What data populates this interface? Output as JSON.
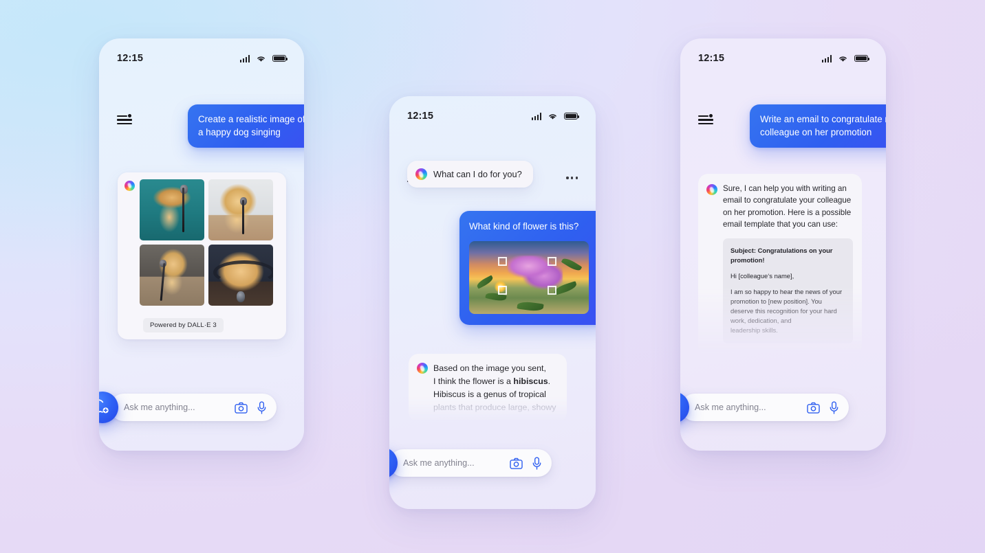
{
  "background": {
    "from": "#cfe9fa",
    "to": "#e6d9f5"
  },
  "accent": {
    "blue": "#2f5ff0",
    "bubble_user_bg": "#3574f0",
    "bot_bubble_bg": "#f6f5fa"
  },
  "status_bar": {
    "time": "12:15",
    "icons": [
      "signal-icon",
      "wifi-icon",
      "battery-icon"
    ]
  },
  "nav": {
    "menu_icon": "list-options-icon",
    "overflow_icon": "more-options-icon"
  },
  "composer": {
    "placeholder": "Ask me anything...",
    "camera_icon": "camera-icon",
    "mic_icon": "microphone-icon",
    "new_chat_icon": "new-chat-icon"
  },
  "phones": [
    {
      "id": "left",
      "name": "image-generation-conversation",
      "messages": [
        {
          "role": "user",
          "text": "Create a realistic image of a happy dog singing"
        }
      ],
      "image_card": {
        "avatar": "copilot-logo",
        "badge": "Powered by DALL·E 3",
        "thumbnails": [
          {
            "alt": "dog standing singing into microphone on teal background"
          },
          {
            "alt": "golden retriever singing with sheet music"
          },
          {
            "alt": "dog sitting beside microphone stand on stage"
          },
          {
            "alt": "dog with headphones singing into microphone"
          }
        ]
      }
    },
    {
      "id": "middle",
      "name": "flower-identification-conversation",
      "messages": [
        {
          "role": "assistant",
          "text": "What can I do for you?"
        },
        {
          "role": "user",
          "text": "What kind of flower is this?",
          "attachment": "pink hibiscus flowers at sunset"
        },
        {
          "role": "assistant",
          "lines": [
            "Based on the image you sent,",
            "I think the flower is a ",
            "Hibiscus is a genus of tropical",
            "plants that produce large, showy"
          ],
          "bold_word": "hibiscus",
          "bold_suffix": "."
        }
      ]
    },
    {
      "id": "right",
      "name": "email-drafting-conversation",
      "messages": [
        {
          "role": "user",
          "text": "Write an email to congratulate my colleague on her promotion"
        },
        {
          "role": "assistant",
          "text": "Sure, I can help you with writing an email to congratulate your colleague on her promotion. Here is a possible email template that you can use:"
        }
      ],
      "email_template": {
        "subject": "Subject: Congratulations on your promotion!",
        "greeting": "Hi [colleague‘s name],",
        "body": "I am so happy to hear the news of your promotion to [new position]. You deserve this recognition for your hard work, dedication, and",
        "body_tail": "leadership skills."
      }
    }
  ]
}
